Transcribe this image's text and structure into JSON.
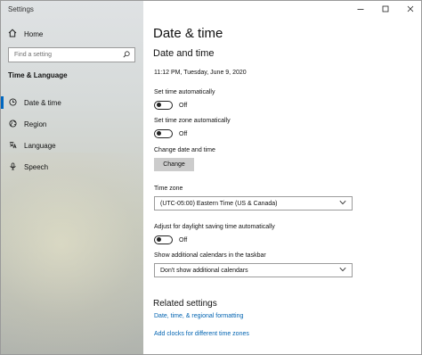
{
  "window": {
    "title": "Settings"
  },
  "sidebar": {
    "home_label": "Home",
    "search_placeholder": "Find a setting",
    "section_title": "Time & Language",
    "items": [
      {
        "label": "Date & time",
        "icon": "clock-icon",
        "active": true
      },
      {
        "label": "Region",
        "icon": "globe-icon",
        "active": false
      },
      {
        "label": "Language",
        "icon": "language-icon",
        "active": false
      },
      {
        "label": "Speech",
        "icon": "microphone-icon",
        "active": false
      }
    ]
  },
  "main": {
    "page_title": "Date & time",
    "subtitle": "Date and time",
    "current_datetime": "11:12 PM, Tuesday, June 9, 2020",
    "set_time_auto": {
      "label": "Set time automatically",
      "state": "Off"
    },
    "set_timezone_auto": {
      "label": "Set time zone automatically",
      "state": "Off"
    },
    "change_date_time": {
      "label": "Change date and time",
      "button": "Change"
    },
    "time_zone": {
      "label": "Time zone",
      "value": "(UTC-05:00) Eastern Time (US & Canada)"
    },
    "daylight_saving": {
      "label": "Adjust for daylight saving time automatically",
      "state": "Off"
    },
    "additional_calendars": {
      "label": "Show additional calendars in the taskbar",
      "value": "Don't show additional calendars"
    },
    "related": {
      "title": "Related settings",
      "links": [
        "Date, time, & regional formatting",
        "Add clocks for different time zones"
      ]
    }
  },
  "colors": {
    "accent": "#0067c0",
    "link": "#0063b1"
  }
}
